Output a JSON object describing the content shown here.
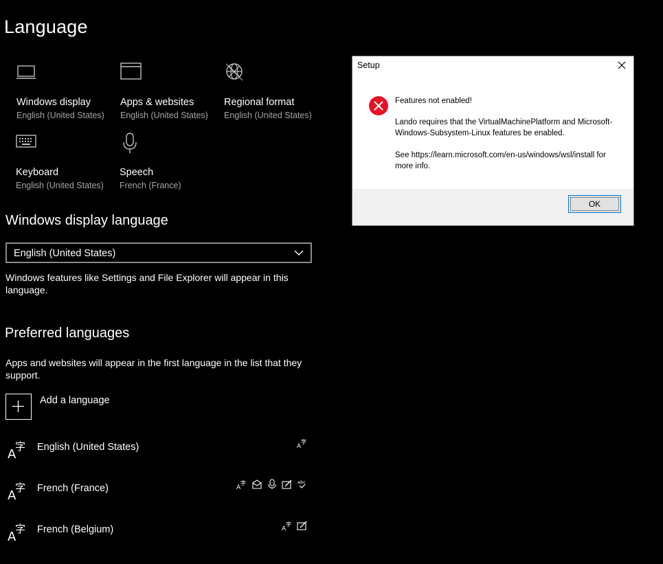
{
  "page": {
    "title": "Language"
  },
  "tiles": [
    {
      "title": "Windows display",
      "subtitle": "English (United States)",
      "icon": "monitor-icon"
    },
    {
      "title": "Apps & websites",
      "subtitle": "English (United States)",
      "icon": "window-icon"
    },
    {
      "title": "Regional format",
      "subtitle": "English (United States)",
      "icon": "globe-icon"
    },
    {
      "title": "Keyboard",
      "subtitle": "English (United States)",
      "icon": "keyboard-icon"
    },
    {
      "title": "Speech",
      "subtitle": "French (France)",
      "icon": "microphone-icon"
    }
  ],
  "display_language": {
    "heading": "Windows display language",
    "selected": "English (United States)",
    "description": "Windows features like Settings and File Explorer will appear in this language."
  },
  "preferred": {
    "heading": "Preferred languages",
    "description": "Apps and websites will appear in the first language in the list that they support.",
    "add_label": "Add a language",
    "languages": [
      {
        "name": "English (United States)",
        "features": [
          "display-language-icon"
        ]
      },
      {
        "name": "French (France)",
        "features": [
          "display-language-icon",
          "text-to-speech-icon",
          "speech-recognition-icon",
          "handwriting-icon",
          "spell-check-icon"
        ]
      },
      {
        "name": "French (Belgium)",
        "features": [
          "display-language-icon",
          "handwriting-icon"
        ]
      }
    ]
  },
  "dialog": {
    "title": "Setup",
    "heading": "Features not enabled!",
    "message": "Lando requires that the VirtualMachinePlatform and Microsoft-Windows-Subsystem-Linux features be enabled.",
    "link_text": "See https://learn.microsoft.com/en-us/windows/wsl/install for more info.",
    "ok_label": "OK",
    "icon": "error-icon",
    "error_color": "#e81123"
  }
}
